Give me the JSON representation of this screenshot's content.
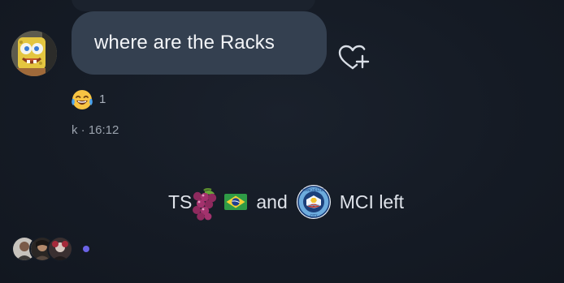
{
  "message": {
    "text": "where are the Racks",
    "reaction_icon": "laughing-tears-emoji-icon",
    "reaction_count": "1",
    "meta": "k · 16:12"
  },
  "system_message": {
    "prefix": "TS",
    "conjunction": "and",
    "suffix": "MCI left",
    "icons": [
      "grapes-emoji-icon",
      "brazil-flag-icon",
      "man-city-crest-icon"
    ]
  },
  "seen_by": {
    "avatars": [
      "seen-avatar-1",
      "seen-avatar-2",
      "seen-avatar-3"
    ],
    "typing_dot_color": "#6b63e6"
  },
  "colors": {
    "background": "#141a24",
    "bubble": "#344050",
    "text": "#f2f4f7",
    "muted": "#9aa2ad"
  }
}
